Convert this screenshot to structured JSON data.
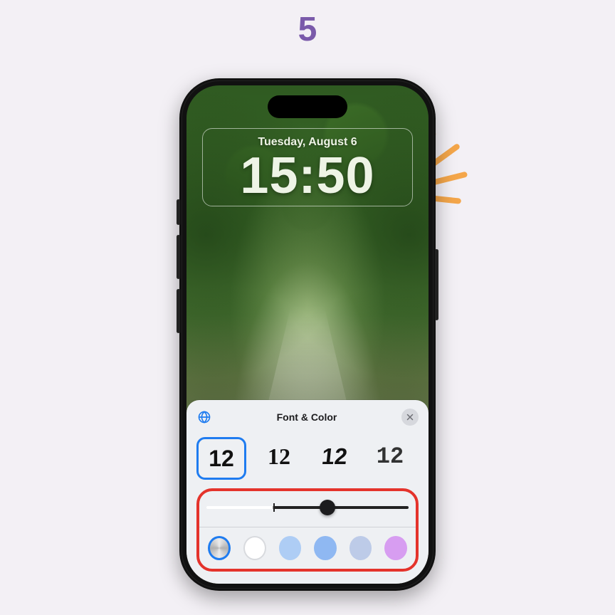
{
  "step_number": "5",
  "lockscreen": {
    "date": "Tuesday, August 6",
    "time": "15:50"
  },
  "sheet": {
    "title": "Font & Color",
    "globe_icon": "globe-icon",
    "close_icon": "close-icon",
    "font_options": [
      {
        "sample": "12",
        "selected": true
      },
      {
        "sample": "12",
        "selected": false
      },
      {
        "sample": "12",
        "selected": false
      },
      {
        "sample": "12",
        "selected": false
      }
    ],
    "slider": {
      "value_pct": 60
    },
    "color_swatches": [
      {
        "name": "color-picker",
        "hex": "multicolor",
        "selected": true
      },
      {
        "name": "white",
        "hex": "#ffffff",
        "selected": false
      },
      {
        "name": "light-blue",
        "hex": "#aecdf5",
        "selected": false
      },
      {
        "name": "blue",
        "hex": "#8fb8f2",
        "selected": false
      },
      {
        "name": "grey-blue",
        "hex": "#bdcbe8",
        "selected": false
      },
      {
        "name": "purple",
        "hex": "#d79df1",
        "selected": false
      }
    ],
    "highlight_color": "#e4332b"
  },
  "annotation": {
    "burst_color": "#f4a64a"
  }
}
